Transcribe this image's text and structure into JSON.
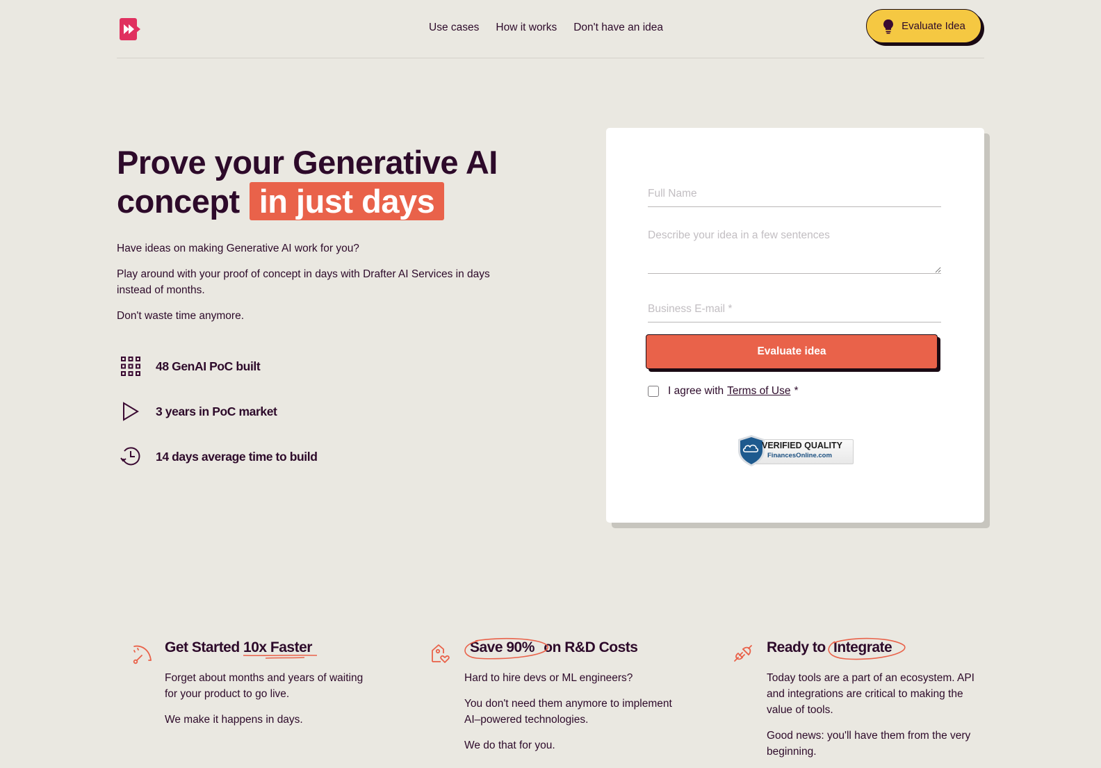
{
  "header": {
    "logo_icon": "fast-forward-logo-icon",
    "nav": [
      {
        "label": "Use cases"
      },
      {
        "label": "How it works"
      },
      {
        "label": "Don't have an idea"
      }
    ],
    "cta_label": "Evaluate Idea",
    "cta_icon": "lightbulb-icon"
  },
  "hero": {
    "title_line1": "Prove your Generative AI",
    "title_line2": "concept",
    "title_highlight": "in just days",
    "paragraphs": [
      "Have ideas on making Generative AI work for you?",
      "Play around with your proof of concept in days with Drafter AI Services in days instead of months.",
      "Don't waste time anymore."
    ],
    "stats": [
      {
        "icon": "grid-icon",
        "label": "48 GenAI PoC built"
      },
      {
        "icon": "play-icon",
        "label": "3 years in PoC market"
      },
      {
        "icon": "clock-history-icon",
        "label": "14 days average time to build"
      }
    ]
  },
  "form": {
    "full_name_placeholder": "Full Name",
    "full_name_value": "",
    "idea_placeholder": "Describe your idea in a few sentences",
    "idea_value": "",
    "email_placeholder": "Business E-mail *",
    "email_value": "",
    "submit_label": "Evaluate idea",
    "agree_prefix": "I agree with",
    "terms_link": "Terms of Use",
    "agree_suffix": "*",
    "agree_checked": false,
    "badge_title": "VERIFIED QUALITY",
    "badge_subtitle": "FinancesOnline.com"
  },
  "features": [
    {
      "icon": "speedometer-icon",
      "title_prefix": "Get Started ",
      "title_mark": "10x Faster",
      "title_suffix": "",
      "body": [
        "Forget about months and years of waiting for your product to go live.",
        "We make it happens in days."
      ]
    },
    {
      "icon": "house-heart-icon",
      "title_prefix": "",
      "title_mark": "Save 90%",
      "title_suffix": " on R&D Costs",
      "body": [
        "Hard to hire devs or ML engineers?",
        "You don't need them anymore to implement AI–powered technologies.",
        "We do that for you."
      ]
    },
    {
      "icon": "plug-icon",
      "title_prefix": "Ready to ",
      "title_mark": "Integrate",
      "title_suffix": "",
      "body": [
        "Today tools are a part of an ecosystem. API and integrations are critical to making the value of tools.",
        "Good news: you'll have them from the very beginning."
      ]
    }
  ],
  "colors": {
    "background": "#eae8e1",
    "text_primary": "#2d0a2a",
    "accent_orange": "#e9624a",
    "accent_yellow": "#f5c842",
    "logo_pink": "#e0305f"
  }
}
